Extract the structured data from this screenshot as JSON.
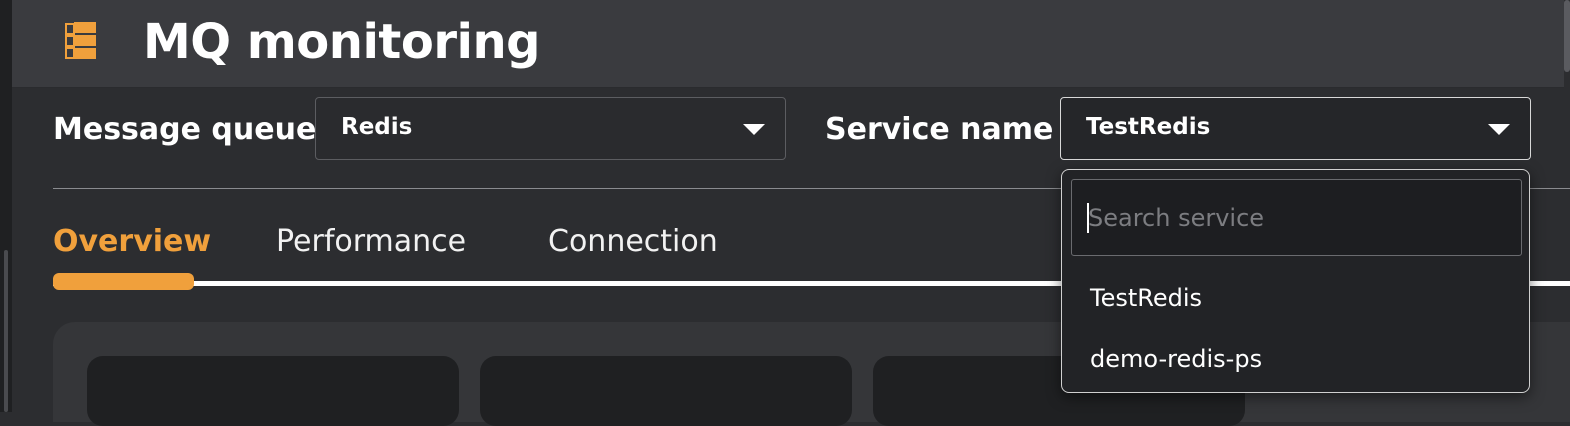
{
  "header": {
    "title": "MQ monitoring",
    "logo_icon": "queue-stack-icon"
  },
  "filters": {
    "message_queue": {
      "label": "Message queue :",
      "value": "Redis"
    },
    "service_name": {
      "label": "Service name :",
      "value": "TestRedis"
    }
  },
  "tabs": [
    {
      "label": "Overview",
      "active": true
    },
    {
      "label": "Performance",
      "active": false
    },
    {
      "label": "Connection",
      "active": false
    }
  ],
  "service_dropdown": {
    "search_placeholder": "Search service",
    "options": [
      "TestRedis",
      "demo-redis-ps"
    ]
  },
  "colors": {
    "accent": "#f0a03c",
    "background": "#2c2d30",
    "header": "#3a3b3f"
  }
}
